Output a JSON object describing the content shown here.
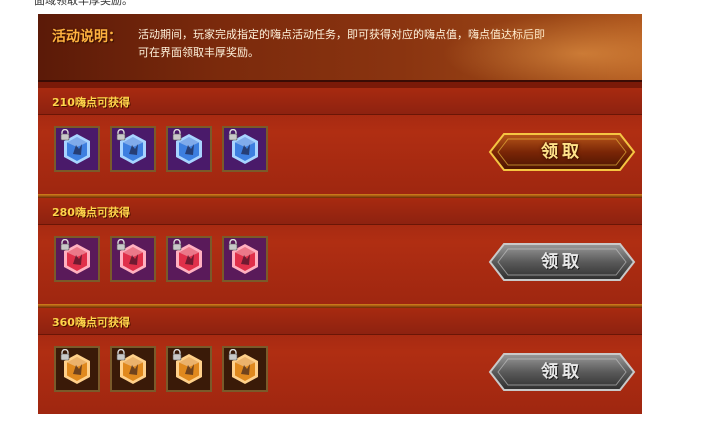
{
  "page": {
    "top_caption": "面域领取丰厚奖励。"
  },
  "header": {
    "label": "活动说明：",
    "lines": [
      "活动期间，玩家完成指定的嗨点活动任务，即可获得对应的嗨点值，嗨点值达标后即",
      "可在界面领取丰厚奖励。"
    ]
  },
  "tiers": [
    {
      "title": "210嗨点可获得",
      "gem_color": "#3d7fe0",
      "gem_edge": "#a8d4ff",
      "slot_bg": "#4a1a6a",
      "items": [
        "locked-blue-gem",
        "locked-blue-gem",
        "locked-blue-gem",
        "locked-blue-gem"
      ],
      "claim_label": "领取",
      "claim_state": "active"
    },
    {
      "title": "280嗨点可获得",
      "gem_color": "#e0304a",
      "gem_edge": "#ffb0c0",
      "slot_bg": "#5a1a5a",
      "items": [
        "locked-red-gem",
        "locked-red-gem",
        "locked-red-gem",
        "locked-red-gem"
      ],
      "claim_label": "领取",
      "claim_state": "disabled"
    },
    {
      "title": "360嗨点可获得",
      "gem_color": "#e0891e",
      "gem_edge": "#ffd08a",
      "slot_bg": "#3a1a08",
      "items": [
        "locked-orange-gem",
        "locked-orange-gem",
        "locked-orange-gem",
        "locked-orange-gem"
      ],
      "claim_label": "领取",
      "claim_state": "disabled"
    }
  ],
  "colors": {
    "tier_title": "#ffd54a",
    "header_label": "#ffb240",
    "claim_active": "#ffe38a",
    "claim_disabled": "#e8e8e8"
  }
}
